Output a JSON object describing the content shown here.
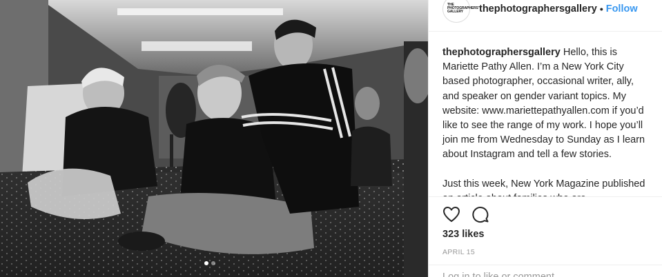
{
  "post": {
    "username": "thephotographersgallery",
    "separator": "•",
    "follow_label": "Follow",
    "avatar_text": "THE PHOTOGRAPHERS' GALLERY",
    "avatar_lines": [
      "THE",
      "PHOTOGRAPHERS'",
      "GALLERY"
    ],
    "caption_username": "thephotographersgallery",
    "caption_p1": "Hello, this is Mariette Pathy Allen. I’m a New York City based photographer, occasional writer, ally, and speaker on gender variant topics. My website: www.mariettepathyallen.com if you’d like to see the range of my work. I hope you’ll join me from Wednesday to Sunday as I learn about Instagram and tell a few stories.",
    "caption_p2": "Just this week, New York Magazine published an article about families who are",
    "likes": "323 likes",
    "date": "APRIL 15",
    "login_prompt": "Log in to like or comment."
  },
  "icons": {
    "like": "heart-icon",
    "comment": "comment-icon"
  },
  "carousel": {
    "count": 2,
    "active_index": 0
  },
  "colors": {
    "link_blue": "#3897f0",
    "text": "#262626",
    "muted": "#999999"
  }
}
